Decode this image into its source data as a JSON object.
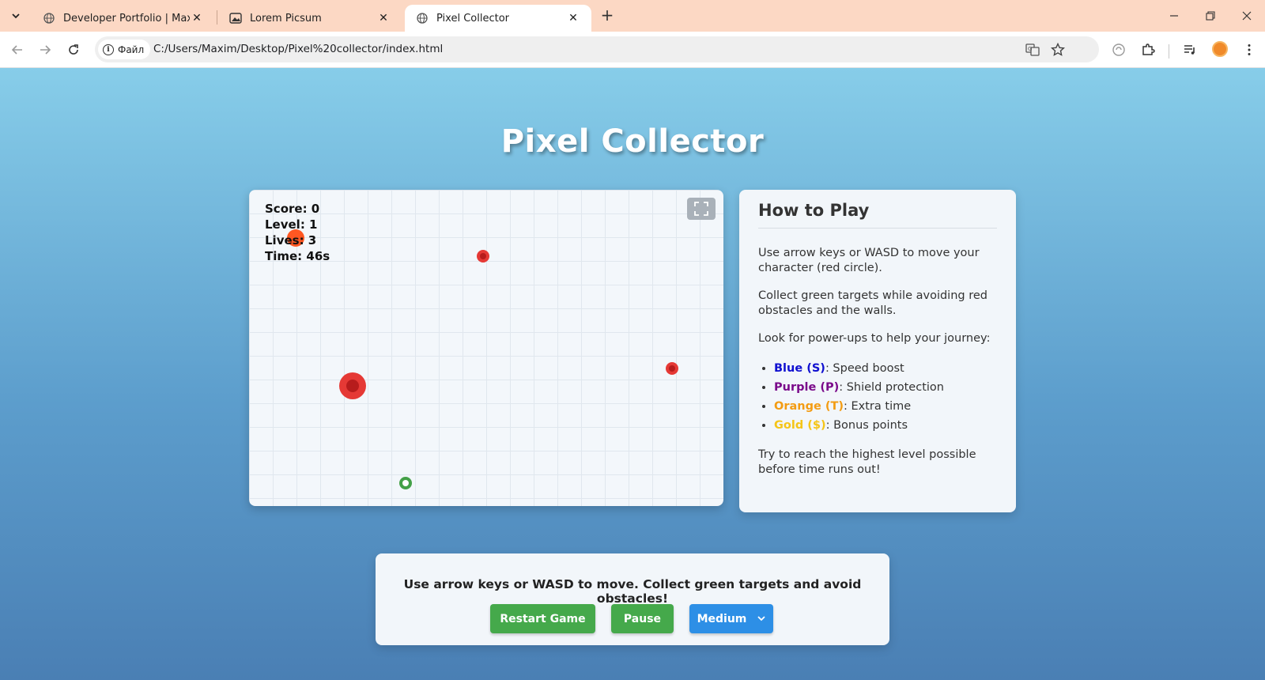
{
  "browser": {
    "tabs": [
      {
        "title": "Developer Portfolio | Maxim Mk",
        "icon": "globe-icon",
        "active": false
      },
      {
        "title": "Lorem Picsum",
        "icon": "image-icon",
        "active": false
      },
      {
        "title": "Pixel Collector",
        "icon": "globe-icon",
        "active": true
      }
    ],
    "site_chip_label": "Файл",
    "url": "C:/Users/Maxim/Desktop/Pixel%20collector/index.html"
  },
  "game": {
    "title": "Pixel Collector",
    "hud": {
      "score": "Score: 0",
      "level": "Level: 1",
      "lives": "Lives: 3",
      "time": "Time: 46s"
    },
    "colors": {
      "obstacle": "#e53935",
      "obstacle_core": "#b71c1c",
      "player": "#ff5722",
      "target": "#43a047"
    }
  },
  "howto": {
    "heading": "How to Play",
    "p1": "Use arrow keys or WASD to move your character (red circle).",
    "p2": "Collect green targets while avoiding red obstacles and the walls.",
    "p3": "Look for power-ups to help your journey:",
    "powerups": [
      {
        "name": "Blue (S)",
        "desc": ": Speed boost",
        "color": "#1010d0"
      },
      {
        "name": "Purple (P)",
        "desc": ": Shield protection",
        "color": "#7a0a8a"
      },
      {
        "name": "Orange (T)",
        "desc": ": Extra time",
        "color": "#f39c12"
      },
      {
        "name": "Gold ($)",
        "desc": ": Bonus points",
        "color": "#f5c518"
      }
    ],
    "p4": "Try to reach the highest level possible before time runs out!"
  },
  "controls": {
    "message": "Use arrow keys or WASD to move. Collect green targets and avoid obstacles!",
    "restart_label": "Restart Game",
    "pause_label": "Pause",
    "difficulty_selected": "Medium"
  }
}
